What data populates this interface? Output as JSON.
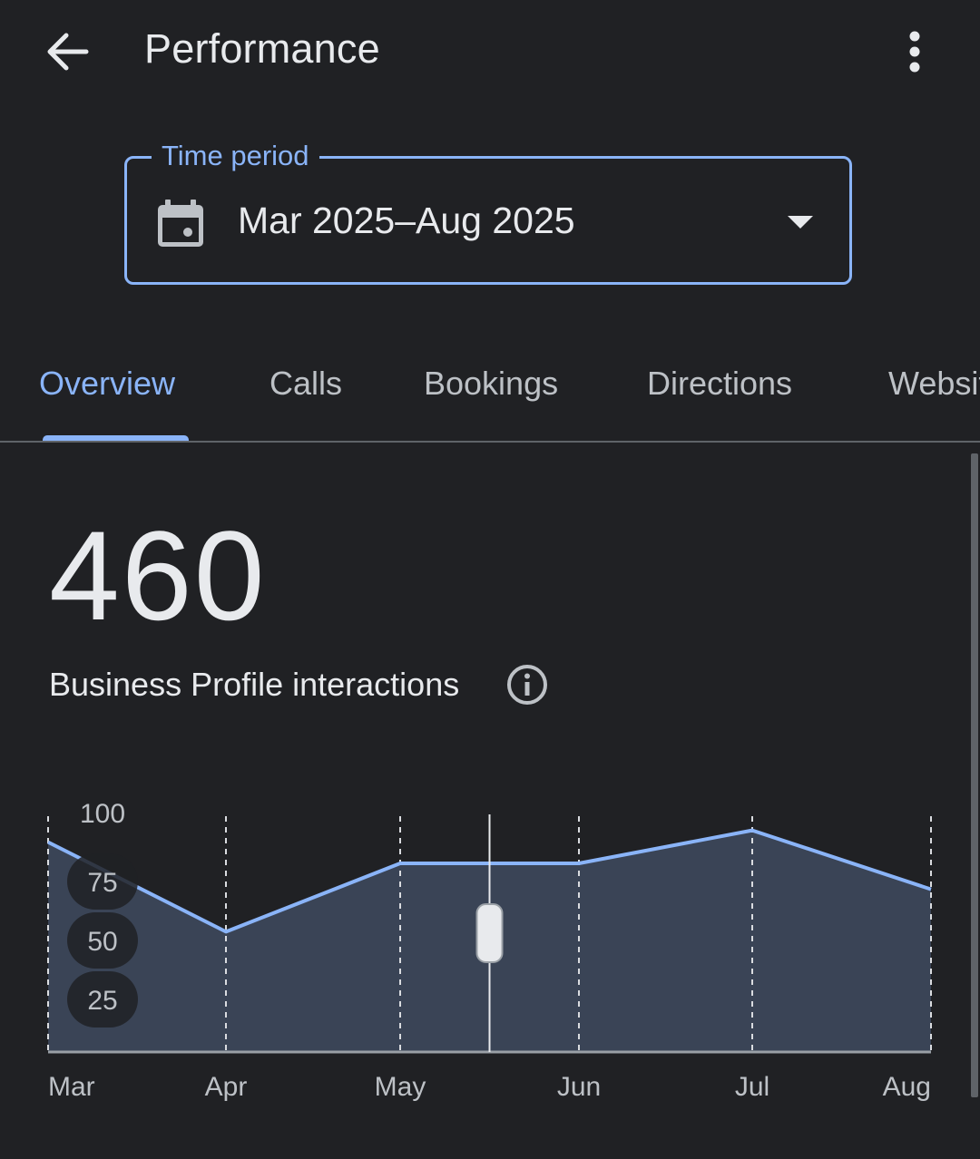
{
  "appbar": {
    "title": "Performance",
    "back_icon": "arrow-back-icon",
    "more_icon": "more-vert-icon"
  },
  "time_period": {
    "label": "Time period",
    "value": "Mar 2025–Aug 2025",
    "icon": "calendar-icon",
    "dropdown_icon": "dropdown-arrow-icon"
  },
  "tabs": [
    {
      "label": "Overview",
      "active": true
    },
    {
      "label": "Calls",
      "active": false
    },
    {
      "label": "Bookings",
      "active": false
    },
    {
      "label": "Directions",
      "active": false
    },
    {
      "label": "Website clicks",
      "active": false
    }
  ],
  "summary": {
    "total": "460",
    "metric_label": "Business Profile interactions",
    "info_icon": "info-icon"
  },
  "colors": {
    "background": "#202124",
    "accent": "#8ab4f8",
    "area_fill": "#3a4456",
    "text_primary": "#e8eaed",
    "text_secondary": "#bdc1c6"
  },
  "chart_data": {
    "type": "area",
    "categories": [
      "Mar",
      "Apr",
      "May",
      "Jun",
      "Jul",
      "Aug"
    ],
    "values": [
      89,
      51,
      80,
      80,
      94,
      69
    ],
    "ylim": [
      0,
      100
    ],
    "yticks": [
      "100",
      "75",
      "50",
      "25"
    ],
    "grid": "vertical dashed",
    "scrubber_position": 0.5
  }
}
